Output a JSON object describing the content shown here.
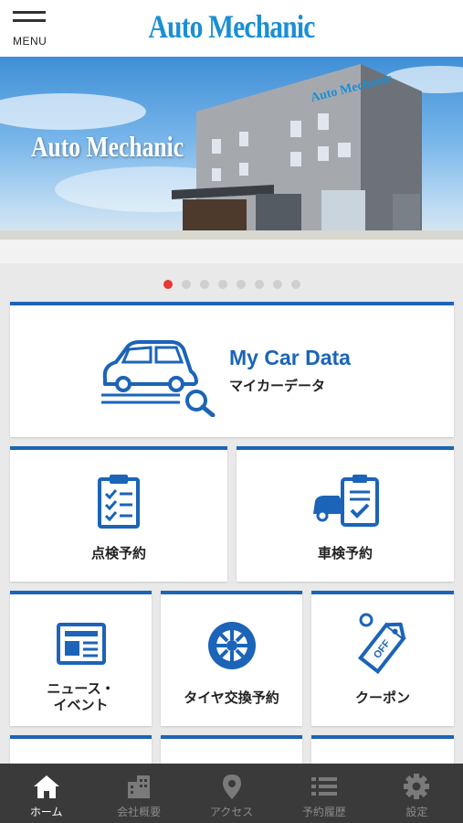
{
  "header": {
    "menu_label": "MENU",
    "logo": "Auto Mechanic"
  },
  "hero": {
    "logo": "Auto Mechanic",
    "sign": "Auto Mechanic",
    "slide_count": 8,
    "active_slide": 1
  },
  "cards": {
    "mycar": {
      "title": "My Car Data",
      "subtitle": "マイカーデータ"
    },
    "inspection": {
      "label": "点検予約"
    },
    "shaken": {
      "label": "車検予約"
    },
    "news": {
      "label_line1": "ニュース・",
      "label_line2": "イベント"
    },
    "tire": {
      "label": "タイヤ交換予約"
    },
    "coupon": {
      "label": "クーポン"
    }
  },
  "tabs": [
    {
      "label": "ホーム",
      "icon": "home-icon",
      "active": true
    },
    {
      "label": "会社概要",
      "icon": "building-icon",
      "active": false
    },
    {
      "label": "アクセス",
      "icon": "map-pin-icon",
      "active": false
    },
    {
      "label": "予約履歴",
      "icon": "list-icon",
      "active": false
    },
    {
      "label": "設定",
      "icon": "gear-icon",
      "active": false
    }
  ],
  "colors": {
    "accent": "#1b64b8",
    "logo": "#1a8fd6",
    "active_dot": "#e53935",
    "tabbar": "#3a3a3a"
  }
}
